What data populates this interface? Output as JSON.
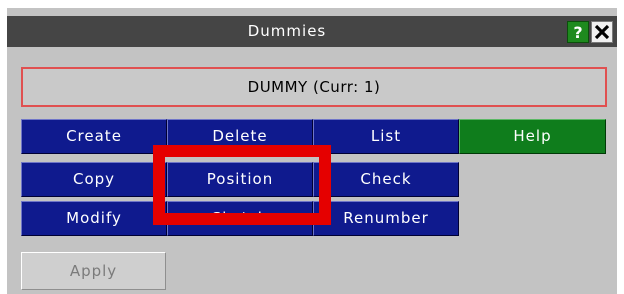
{
  "window": {
    "title": "Dummies",
    "help_icon_label": "?",
    "close_icon": "close-icon"
  },
  "group_header": {
    "label": "DUMMY (Curr: 1)"
  },
  "buttons": {
    "create": "Create",
    "delete": "Delete",
    "list": "List",
    "help": "Help",
    "copy": "Copy",
    "position": "Position",
    "check": "Check",
    "modify": "Modify",
    "sketch": "Sketch",
    "renumber": "Renumber",
    "apply": "Apply"
  },
  "colors": {
    "button_blue": "#0f1a8e",
    "button_green": "#0f7d1c",
    "highlight_red": "#e50000",
    "titlebar": "#454545",
    "panel": "#c3c3c3"
  }
}
